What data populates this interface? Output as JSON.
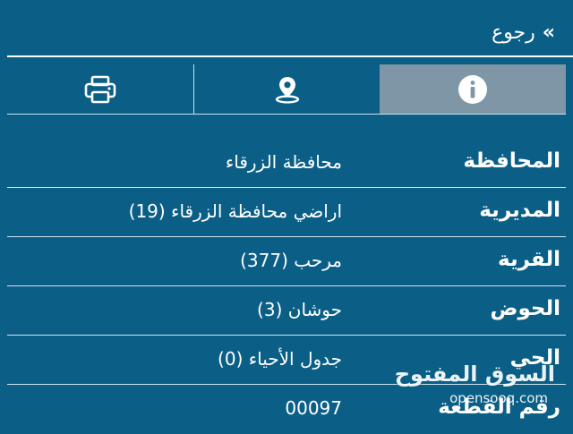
{
  "header": {
    "back_label": "رجوع",
    "back_icon": "double-chevron-left"
  },
  "tabs": [
    {
      "icon": "info-icon",
      "active": true
    },
    {
      "icon": "location-pin-icon",
      "active": false
    },
    {
      "icon": "printer-icon",
      "active": false
    }
  ],
  "details": [
    {
      "label": "المحافظة",
      "value": "محافظة الزرقاء"
    },
    {
      "label": "المديرية",
      "value": "اراضي محافظة الزرقاء (19)"
    },
    {
      "label": "القرية",
      "value": "مرحب (377)"
    },
    {
      "label": "الحوض",
      "value": "حوشان (3)"
    },
    {
      "label": "الحي",
      "value": "جدول الأحياء (0)"
    },
    {
      "label": "رقم القطعة",
      "value": "00097"
    }
  ],
  "watermark": {
    "arabic": "السوق المفتوح",
    "latin": "opensooq.com"
  },
  "colors": {
    "background": "#0b5f86",
    "active_tab": "#7f96a6",
    "text": "#ffffff"
  }
}
